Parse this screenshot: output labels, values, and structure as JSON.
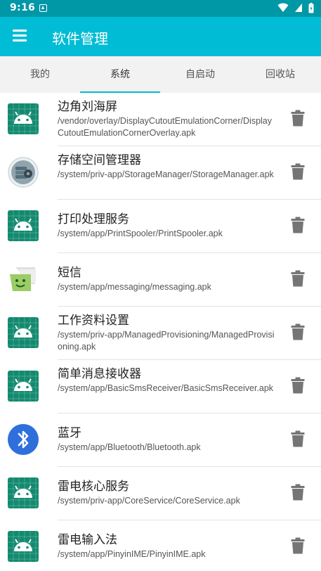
{
  "status_bar": {
    "time": "9:16",
    "icons": [
      "notification-icon",
      "wifi-icon",
      "cellular-icon",
      "battery-icon"
    ]
  },
  "app_bar": {
    "title": "软件管理"
  },
  "tabs": [
    {
      "label": "我的",
      "active": false
    },
    {
      "label": "系统",
      "active": true
    },
    {
      "label": "自启动",
      "active": false
    },
    {
      "label": "回收站",
      "active": false
    }
  ],
  "colors": {
    "status_bar": "#0097a7",
    "app_bar": "#00bcd4",
    "accent": "#00bcd4",
    "android_icon_bg": "#138a6f",
    "bluetooth_icon_bg": "#2f6fdc",
    "messaging_icon_bg": "#9ccc65",
    "trash_icon": "#757575"
  },
  "apps": [
    {
      "name": "边角刘海屏",
      "path": "/vendor/overlay/DisplayCutoutEmulationCorner/DisplayCutoutEmulationCornerOverlay.apk",
      "icon": "android-icon"
    },
    {
      "name": "存储空间管理器",
      "path": "/system/priv-app/StorageManager/StorageManager.apk",
      "icon": "storage-manager-icon"
    },
    {
      "name": "打印处理服务",
      "path": "/system/app/PrintSpooler/PrintSpooler.apk",
      "icon": "android-icon"
    },
    {
      "name": "短信",
      "path": "/system/app/messaging/messaging.apk",
      "icon": "messaging-icon"
    },
    {
      "name": "工作资料设置",
      "path": "/system/priv-app/ManagedProvisioning/ManagedProvisioning.apk",
      "icon": "android-icon"
    },
    {
      "name": "简单消息接收器",
      "path": "/system/app/BasicSmsReceiver/BasicSmsReceiver.apk",
      "icon": "android-icon"
    },
    {
      "name": "蓝牙",
      "path": "/system/app/Bluetooth/Bluetooth.apk",
      "icon": "bluetooth-icon"
    },
    {
      "name": "雷电核心服务",
      "path": "/system/priv-app/CoreService/CoreService.apk",
      "icon": "android-icon"
    },
    {
      "name": "雷电输入法",
      "path": "/system/app/PinyinIME/PinyinIME.apk",
      "icon": "android-icon"
    }
  ]
}
